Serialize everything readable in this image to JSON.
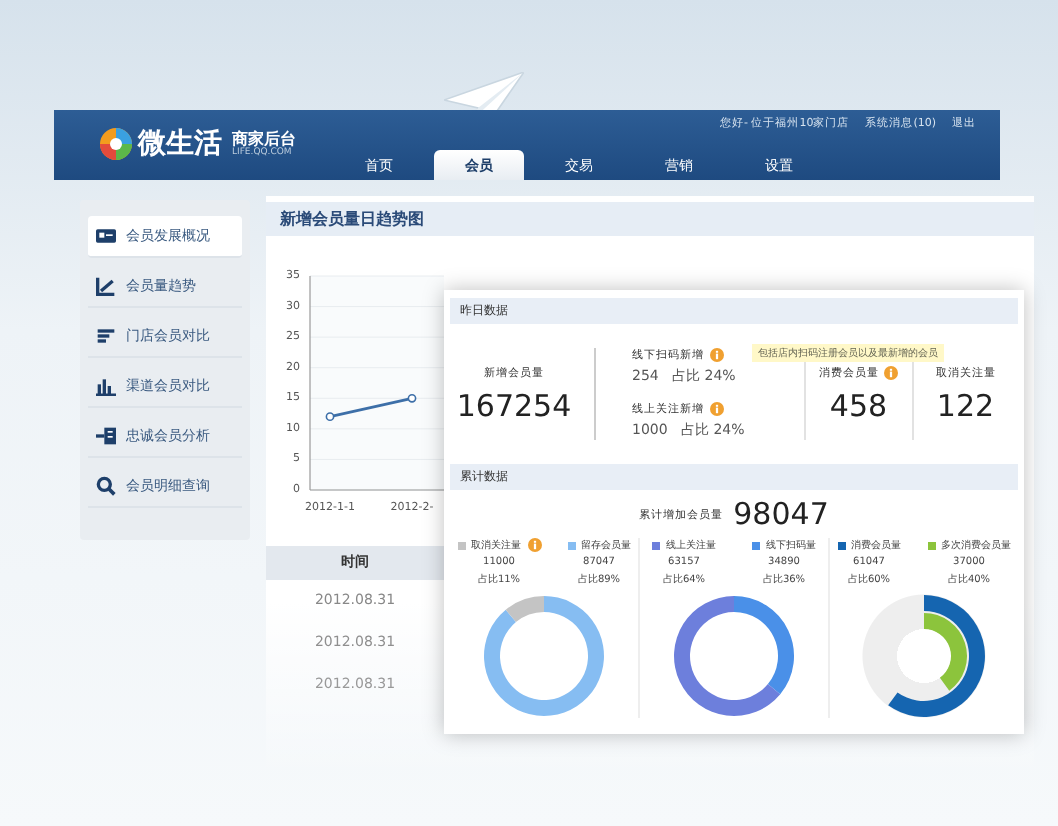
{
  "header": {
    "logo": "微生活",
    "subtitle": "商家后台",
    "domain": "LIFE.QQ.COM",
    "user_links": [
      "您好- 位于福州10家门店",
      "系统消息(10)",
      "退出"
    ],
    "tabs": [
      {
        "label": "首页",
        "selected": false
      },
      {
        "label": "会员",
        "selected": true
      },
      {
        "label": "交易",
        "selected": false
      },
      {
        "label": "营销",
        "selected": false
      },
      {
        "label": "设置",
        "selected": false
      }
    ]
  },
  "sidebar": {
    "items": [
      {
        "label": "会员发展概况",
        "selected": true,
        "kind": "card"
      },
      {
        "label": "会员量趋势",
        "selected": false,
        "kind": "trend"
      },
      {
        "label": "门店会员对比",
        "selected": false,
        "kind": "hbars"
      },
      {
        "label": "渠道会员对比",
        "selected": false,
        "kind": "vbars"
      },
      {
        "label": "忠诚会员分析",
        "selected": false,
        "kind": "flow"
      },
      {
        "label": "会员明细查询",
        "selected": false,
        "kind": "search"
      }
    ]
  },
  "trend": {
    "title": "新增会员量日趋势图",
    "chart_data": {
      "type": "line",
      "categories": [
        "2012-1-1",
        "2012-2-"
      ],
      "series": [
        {
          "color": "#3d6fa8",
          "values": [
            12,
            15
          ]
        }
      ],
      "ylim": [
        0,
        35
      ],
      "yticks": [
        0,
        5,
        10,
        15,
        20,
        25,
        30,
        35
      ],
      "grid": true,
      "marker": true
    }
  },
  "table": {
    "columns": [
      "时间"
    ],
    "rows": [
      [
        "2012.08.31"
      ],
      [
        "2012.08.31"
      ],
      [
        "2012.08.31"
      ]
    ]
  },
  "yesterday": {
    "title": "昨日数据",
    "new_members": {
      "label": "新增会员量",
      "value": "167254"
    },
    "channels": [
      {
        "label": "线下扫码新增",
        "value": "254",
        "share": "占比 24%",
        "info": true,
        "tip": "包括店内扫码注册会员以及最新增的会员"
      },
      {
        "label": "线上关注新增",
        "value": "1000",
        "share": "占比 24%",
        "info": true
      }
    ],
    "metrics": [
      {
        "label": "消费会员量",
        "value": "458",
        "info": true
      },
      {
        "label": "取消关注量",
        "value": "122",
        "info": false
      }
    ]
  },
  "cumulative": {
    "title": "累计数据",
    "total_label": "累计增加会员量",
    "total": "98047",
    "panels": [
      {
        "kind": "ring",
        "legend": [
          {
            "color": "#c4c4c4",
            "count": "11000",
            "share": "占比11%",
            "info": true
          },
          {
            "color": "#86bdf2",
            "count": "87047",
            "share": "占比89%",
            "info": false
          }
        ],
        "chart_data": {
          "type": "donut",
          "categories": [
            "取消关注量",
            "留存会员量"
          ],
          "values": [
            11,
            89
          ]
        }
      },
      {
        "kind": "ring",
        "legend": [
          {
            "color": "#6d7fdc",
            "count": "63157",
            "share": "占比64%",
            "info": false
          },
          {
            "color": "#4a90e8",
            "count": "34890",
            "share": "占比36%",
            "info": false
          }
        ],
        "chart_data": {
          "type": "donut",
          "categories": [
            "线上关注量",
            "线下扫码量"
          ],
          "values": [
            64,
            36
          ]
        }
      },
      {
        "kind": "rings",
        "legend": [
          {
            "label": "消费会员量",
            "color": "#1565b0",
            "count": "61047",
            "share": "占比60%",
            "info": false
          },
          {
            "label": "多次消费会员量",
            "color": "#8cc43c",
            "count": "37000",
            "share": "占比40%",
            "info": false
          }
        ]
      }
    ]
  }
}
